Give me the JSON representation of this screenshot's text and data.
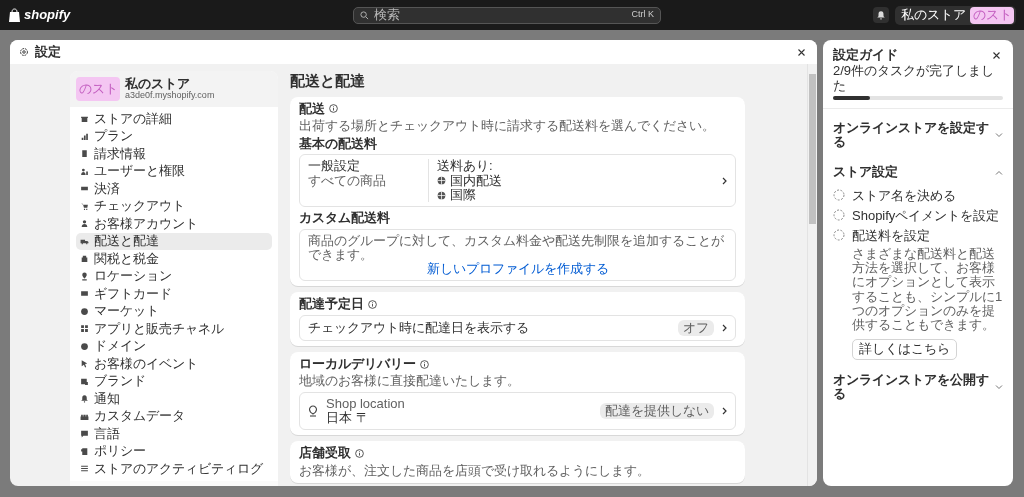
{
  "topbar": {
    "logo": "shopify",
    "search": {
      "placeholder": "検索",
      "shortcut": "Ctrl K"
    },
    "store_name": "私のストア",
    "avatar": "のスト"
  },
  "modal": {
    "title": "設定",
    "sidebar": {
      "store_name": "私のストア",
      "store_url": "a3de0f.myshopify.com",
      "avatar": "のスト",
      "items": [
        {
          "label": "ストアの詳細",
          "selected": false
        },
        {
          "label": "プラン",
          "selected": false
        },
        {
          "label": "請求情報",
          "selected": false
        },
        {
          "label": "ユーザーと権限",
          "selected": false
        },
        {
          "label": "決済",
          "selected": false
        },
        {
          "label": "チェックアウト",
          "selected": false
        },
        {
          "label": "お客様アカウント",
          "selected": false
        },
        {
          "label": "配送と配達",
          "selected": true
        },
        {
          "label": "関税と税金",
          "selected": false
        },
        {
          "label": "ロケーション",
          "selected": false
        },
        {
          "label": "ギフトカード",
          "selected": false
        },
        {
          "label": "マーケット",
          "selected": false
        },
        {
          "label": "アプリと販売チャネル",
          "selected": false
        },
        {
          "label": "ドメイン",
          "selected": false
        },
        {
          "label": "お客様のイベント",
          "selected": false
        },
        {
          "label": "ブランド",
          "selected": false
        },
        {
          "label": "通知",
          "selected": false
        },
        {
          "label": "カスタムデータ",
          "selected": false
        },
        {
          "label": "言語",
          "selected": false
        },
        {
          "label": "ポリシー",
          "selected": false
        },
        {
          "label": "ストアのアクティビティログ",
          "selected": false
        }
      ]
    },
    "page_title": "配送と配達",
    "shipping": {
      "title": "配送",
      "description": "出荷する場所とチェックアウト時に請求する配送料を選んでください。",
      "general_heading": "基本の配送料",
      "general_profile": {
        "name": "一般設定",
        "scope": "すべての商品",
        "rates_label": "送料あり:",
        "zones": [
          "国内配送",
          "国際"
        ]
      },
      "custom_heading": "カスタム配送料",
      "custom_text": "商品のグループに対して、カスタム料金や配送先制限を追加することができます。",
      "custom_link": "新しいプロファイルを作成する"
    },
    "delivery_date": {
      "title": "配達予定日",
      "row": "チェックアウト時に配達日を表示する",
      "badge": "オフ"
    },
    "local_delivery": {
      "title": "ローカルデリバリー",
      "description": "地域のお客様に直接配達いたします。",
      "location_name": "Shop location",
      "location_address": "日本 〒",
      "badge": "配達を提供しない"
    },
    "pickup": {
      "title": "店舗受取",
      "description": "お客様が、注文した商品を店頭で受け取れるようにします。"
    }
  },
  "guide": {
    "title": "設定ガイド",
    "progress_text": "2/9件のタスクが完了しました",
    "level": 0.22,
    "sections": [
      {
        "title": "オンラインストアを設定する",
        "expanded": false
      },
      {
        "title": "ストア設定",
        "expanded": true,
        "tasks": [
          {
            "label": "ストア名を決める",
            "done": false
          },
          {
            "label": "Shopifyペイメントを設定",
            "done": false
          },
          {
            "label": "配送料を設定",
            "done": false,
            "description": "さまざまな配送料と配送方法を選択して、お客様にオプションとして表示することも、シンプルに1つのオプションのみを提供することもできます。",
            "button": "詳しくはこちら"
          }
        ]
      },
      {
        "title": "オンラインストアを公開する",
        "expanded": false
      }
    ]
  }
}
